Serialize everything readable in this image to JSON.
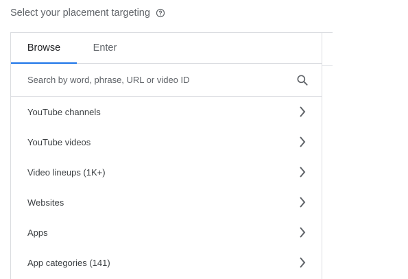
{
  "heading": {
    "title": "Select your placement targeting",
    "help_icon": "help-circle-icon"
  },
  "tabs": [
    {
      "label": "Browse",
      "active": true
    },
    {
      "label": "Enter",
      "active": false
    }
  ],
  "search": {
    "placeholder": "Search by word, phrase, URL or video ID",
    "value": "",
    "icon": "search-icon"
  },
  "categories": [
    {
      "label": "YouTube channels"
    },
    {
      "label": "YouTube videos"
    },
    {
      "label": "Video lineups (1K+)"
    },
    {
      "label": "Websites"
    },
    {
      "label": "Apps"
    },
    {
      "label": "App categories (141)"
    }
  ],
  "colors": {
    "accent": "#1a73e8",
    "text": "#3c4043",
    "muted": "#5f6368",
    "border": "#dadce0"
  }
}
